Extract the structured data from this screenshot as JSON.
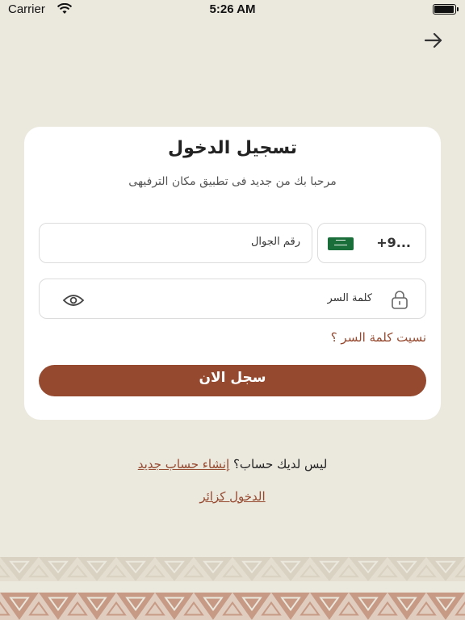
{
  "status_bar": {
    "carrier": "Carrier",
    "time": "5:26 AM"
  },
  "icons": {
    "back": "arrow-right-icon",
    "wifi": "wifi-icon",
    "battery": "battery-icon",
    "flag": "saudi-flag-icon",
    "lock": "lock-icon",
    "eye": "eye-icon"
  },
  "login": {
    "title": "تسجيل الدخول",
    "subtitle": "مرحبا بك من جديد فى تطبيق مكان الترفيهى",
    "phone_label": "رقم الجوال",
    "country_code": "+9...",
    "password_label": "كلمة السر",
    "forgot_password": "نسيت كلمة السر ؟",
    "submit": "سجل الان"
  },
  "footer": {
    "no_account": "ليس لديك حساب؟ ",
    "create_account": "إنشاء حساب جديد",
    "guest_login": "الدخول كزائر"
  },
  "colors": {
    "background": "#ebe8de",
    "accent": "#95492f",
    "card": "#ffffff"
  }
}
